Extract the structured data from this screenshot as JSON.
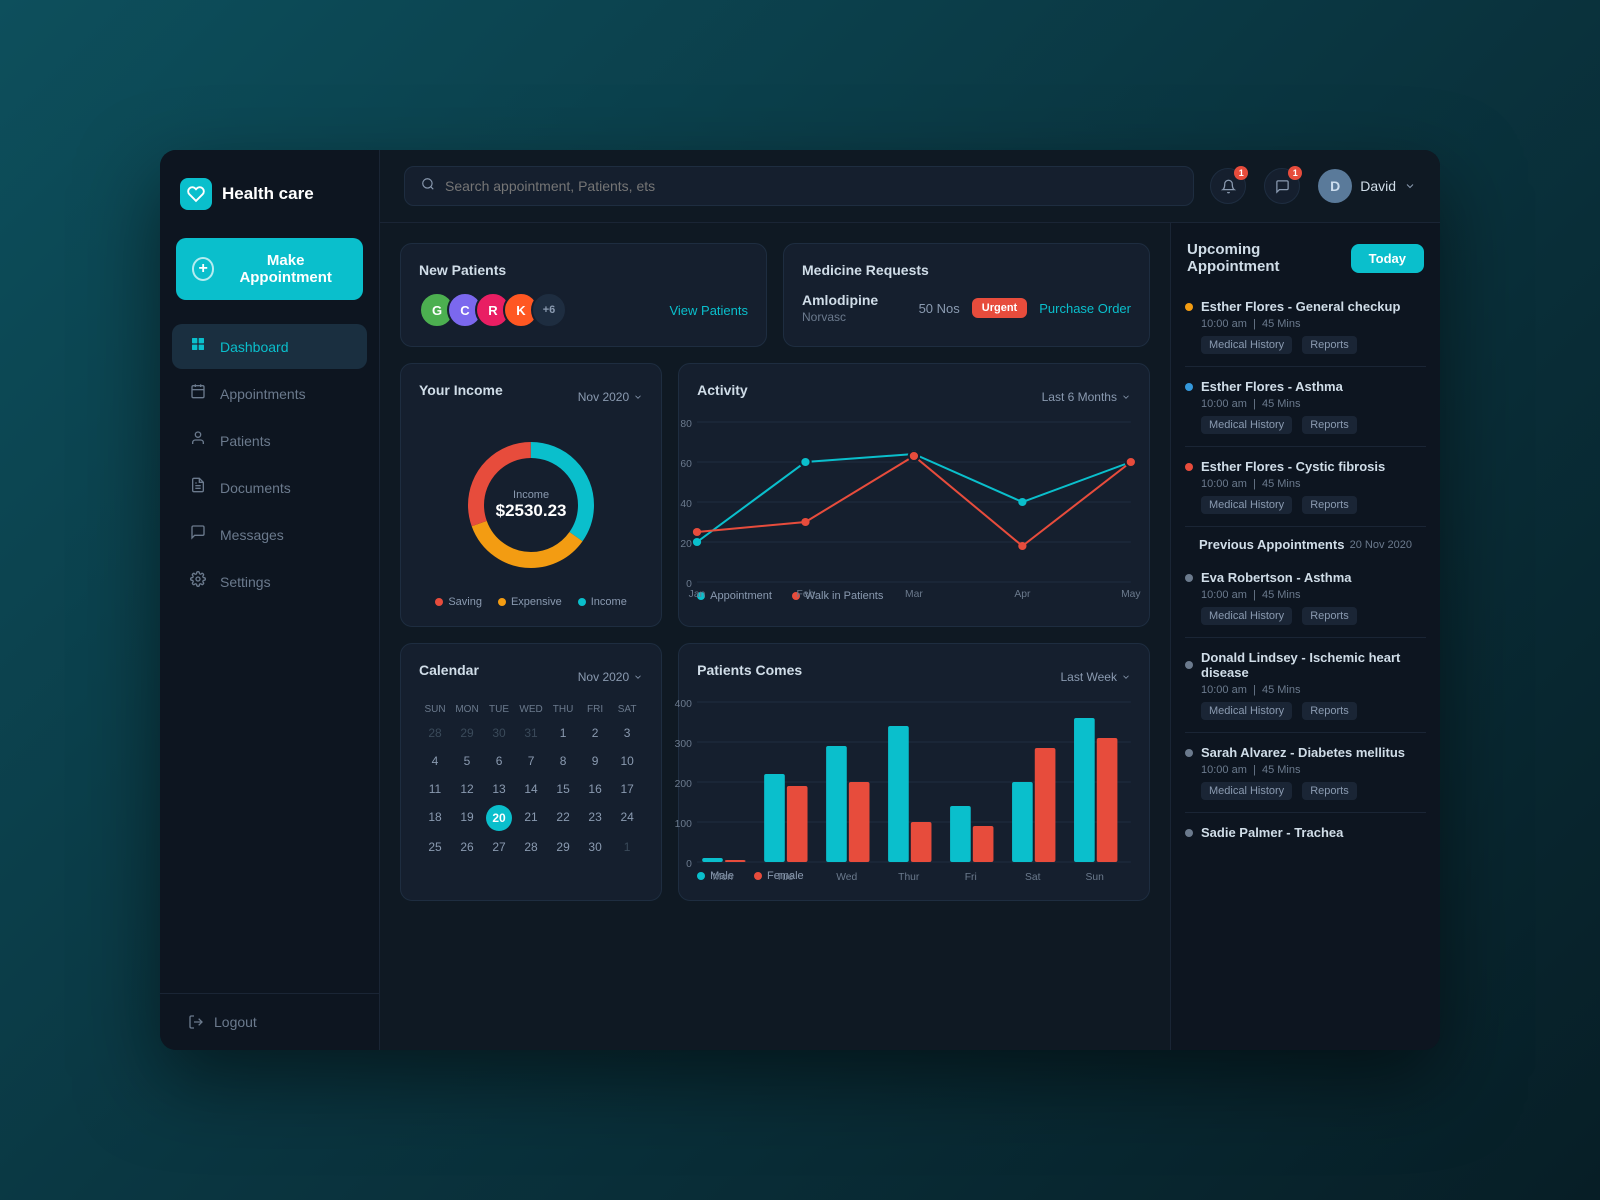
{
  "app": {
    "title": "Health care",
    "logo_emoji": "🏥"
  },
  "sidebar": {
    "nav_items": [
      {
        "id": "dashboard",
        "label": "Dashboard",
        "icon": "⊞",
        "active": true
      },
      {
        "id": "appointments",
        "label": "Appointments",
        "icon": "📅",
        "active": false
      },
      {
        "id": "patients",
        "label": "Patients",
        "icon": "👤",
        "active": false
      },
      {
        "id": "documents",
        "label": "Documents",
        "icon": "📋",
        "active": false
      },
      {
        "id": "messages",
        "label": "Messages",
        "icon": "💬",
        "active": false
      },
      {
        "id": "settings",
        "label": "Settings",
        "icon": "⚙",
        "active": false
      }
    ],
    "make_appointment": "Make Appointment",
    "logout": "Logout"
  },
  "topbar": {
    "search_placeholder": "Search appointment, Patients, ets",
    "user_name": "David",
    "notification_count": "1",
    "message_count": "1"
  },
  "new_patients": {
    "title": "New Patients",
    "view_link": "View Patients",
    "avatars": [
      {
        "letter": "G",
        "color": "#4CAF50"
      },
      {
        "letter": "C",
        "color": "#7B68EE"
      },
      {
        "letter": "R",
        "color": "#E91E63"
      },
      {
        "letter": "K",
        "color": "#FF5722"
      },
      {
        "more": true,
        "label": "+6"
      }
    ]
  },
  "medicine_requests": {
    "title": "Medicine Requests",
    "medicine_name": "Amlodipine",
    "medicine_sub": "Norvasc",
    "count": "50 Nos",
    "urgency": "Urgent",
    "purchase_link": "Purchase Order"
  },
  "income": {
    "title": "Your Income",
    "period": "Nov 2020",
    "value": "$2530.23",
    "label": "Income",
    "legend": [
      {
        "label": "Saving",
        "color": "#e74c3c"
      },
      {
        "label": "Expensive",
        "color": "#f39c12"
      },
      {
        "label": "Income",
        "color": "#0abfcc"
      }
    ]
  },
  "activity": {
    "title": "Activity",
    "period": "Last 6 Months",
    "legend": [
      {
        "label": "Appointment",
        "color": "#0abfcc"
      },
      {
        "label": "Walk in Patients",
        "color": "#e74c3c"
      }
    ],
    "months": [
      "Jan",
      "Feb",
      "Mar",
      "Apr",
      "May"
    ],
    "appointment_data": [
      20,
      60,
      65,
      40,
      60
    ],
    "walkin_data": [
      25,
      30,
      63,
      18,
      60
    ]
  },
  "calendar": {
    "title": "Calendar",
    "period": "Nov 2020",
    "weekdays": [
      "SUN",
      "MON",
      "TUE",
      "WED",
      "THU",
      "FRI",
      "SAT"
    ],
    "rows": [
      [
        {
          "d": "28",
          "om": true
        },
        {
          "d": "29",
          "om": true
        },
        {
          "d": "30",
          "om": true
        },
        {
          "d": "31",
          "om": true
        },
        {
          "d": "1"
        },
        {
          "d": "2"
        },
        {
          "d": "3"
        }
      ],
      [
        {
          "d": "4"
        },
        {
          "d": "5"
        },
        {
          "d": "6"
        },
        {
          "d": "7"
        },
        {
          "d": "8"
        },
        {
          "d": "9"
        },
        {
          "d": "10"
        }
      ],
      [
        {
          "d": "11"
        },
        {
          "d": "12"
        },
        {
          "d": "13"
        },
        {
          "d": "14"
        },
        {
          "d": "15"
        },
        {
          "d": "16"
        },
        {
          "d": "17"
        }
      ],
      [
        {
          "d": "18"
        },
        {
          "d": "19"
        },
        {
          "d": "20"
        },
        {
          "d": "21"
        },
        {
          "d": "22"
        },
        {
          "d": "23"
        },
        {
          "d": "24"
        }
      ],
      [
        {
          "d": "25"
        },
        {
          "d": "26"
        },
        {
          "d": "27"
        },
        {
          "d": "28"
        },
        {
          "d": "29"
        },
        {
          "d": "30"
        },
        {
          "d": "1",
          "om": true
        }
      ]
    ]
  },
  "patients_comes": {
    "title": "Patients Comes",
    "period": "Last Week",
    "days": [
      "Mon",
      "Tue",
      "Wed",
      "Thur",
      "Fri",
      "Sat",
      "Sun"
    ],
    "male": [
      10,
      220,
      290,
      340,
      140,
      200,
      360
    ],
    "female": [
      5,
      190,
      200,
      100,
      90,
      285,
      310
    ],
    "legend": [
      {
        "label": "Male",
        "color": "#0abfcc"
      },
      {
        "label": "Female",
        "color": "#e74c3c"
      }
    ]
  },
  "upcoming_appointments": {
    "title": "Upcoming Appointment",
    "today_btn": "Today",
    "upcoming": [
      {
        "name": "Esther Flores - General checkup",
        "time": "10:00 am",
        "duration": "45 Mins",
        "dot_color": "#f39c12",
        "actions": [
          "Medical History",
          "Reports"
        ]
      },
      {
        "name": "Esther Flores - Asthma",
        "time": "10:00 am",
        "duration": "45 Mins",
        "dot_color": "#3498db",
        "actions": [
          "Medical History",
          "Reports"
        ]
      },
      {
        "name": "Esther Flores - Cystic fibrosis",
        "time": "10:00 am",
        "duration": "45 Mins",
        "dot_color": "#e74c3c",
        "actions": [
          "Medical History",
          "Reports"
        ]
      }
    ],
    "previous_section": "Previous Appointments",
    "previous_date": "20 Nov 2020",
    "previous": [
      {
        "name": "Eva Robertson - Asthma",
        "time": "10:00 am",
        "duration": "45 Mins",
        "dot_color": "#6b7a8d",
        "actions": [
          "Medical History",
          "Reports"
        ]
      },
      {
        "name": "Donald Lindsey - Ischemic heart disease",
        "time": "10:00 am",
        "duration": "45 Mins",
        "dot_color": "#6b7a8d",
        "actions": [
          "Medical History",
          "Reports"
        ]
      },
      {
        "name": "Sarah Alvarez - Diabetes mellitus",
        "time": "10:00 am",
        "duration": "45 Mins",
        "dot_color": "#6b7a8d",
        "actions": [
          "Medical History",
          "Reports"
        ]
      },
      {
        "name": "Sadie Palmer - Trachea",
        "time": "",
        "duration": "",
        "dot_color": "#6b7a8d",
        "actions": []
      }
    ]
  }
}
